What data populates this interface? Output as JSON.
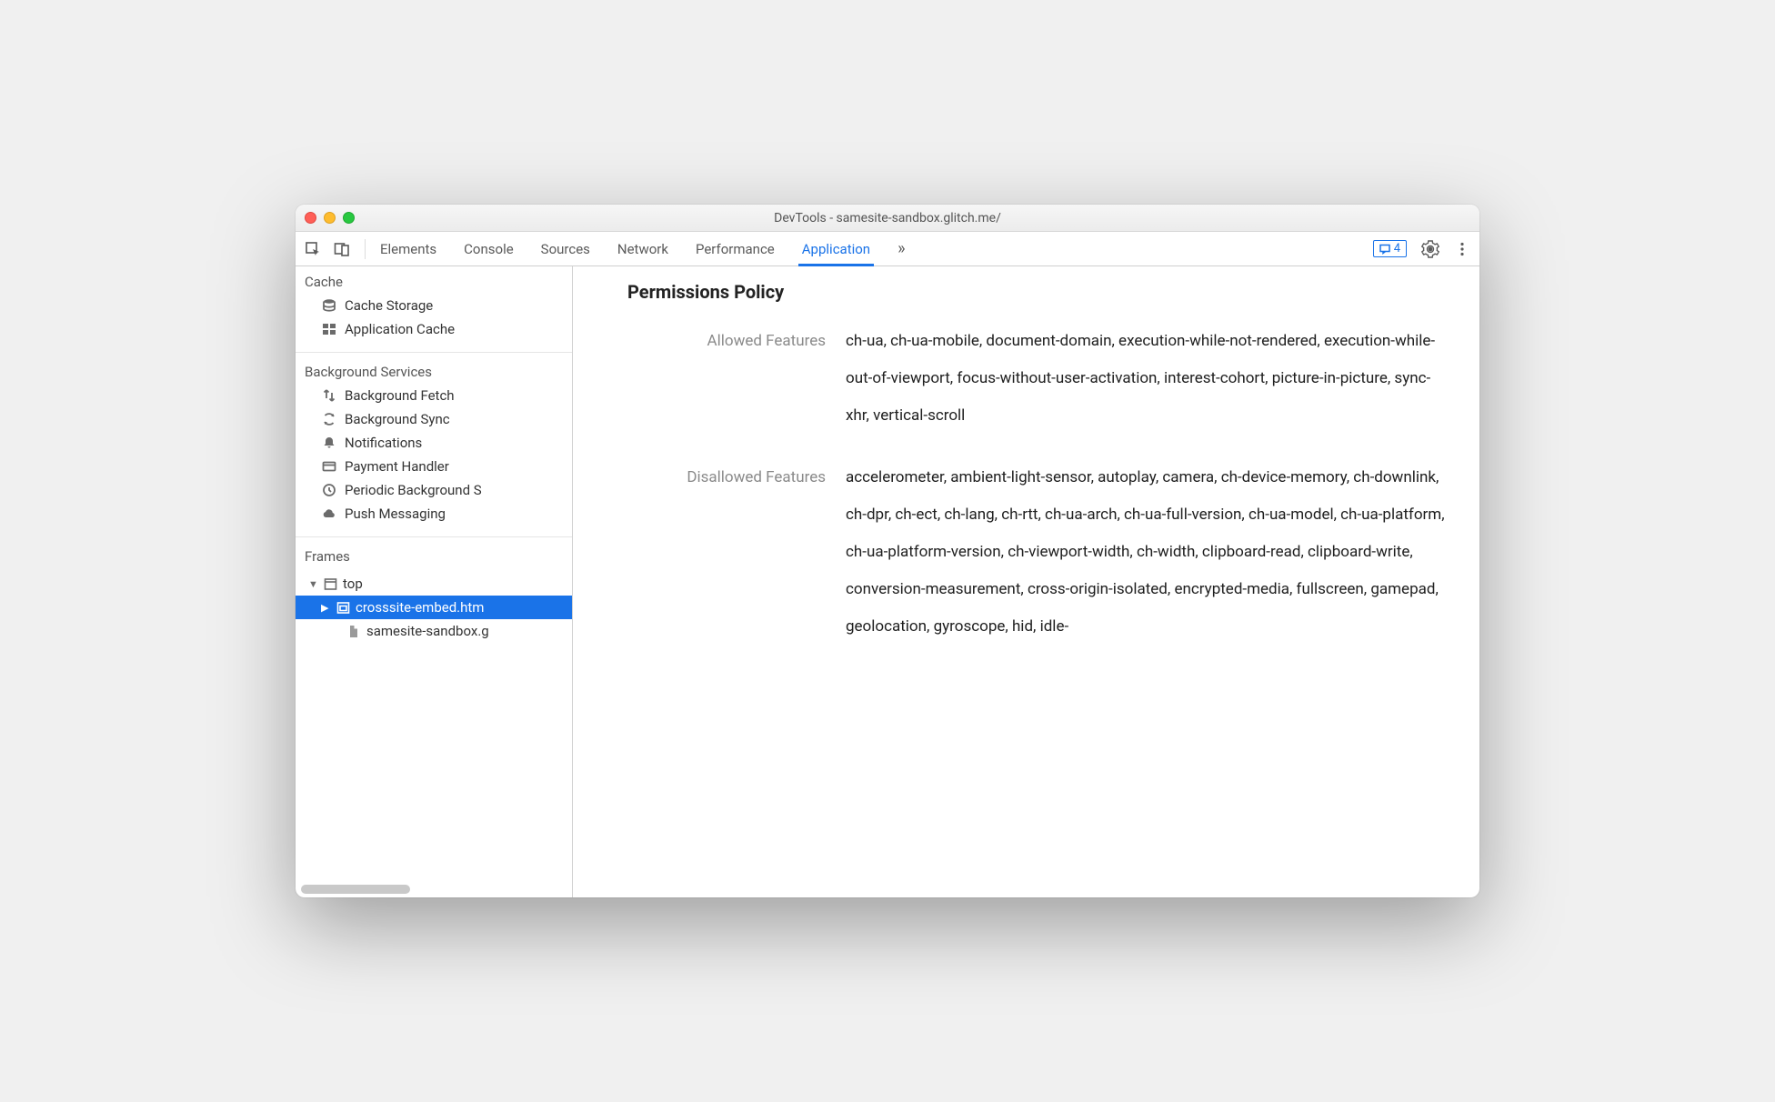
{
  "window": {
    "title": "DevTools - samesite-sandbox.glitch.me/"
  },
  "tabs": {
    "items": [
      "Elements",
      "Console",
      "Sources",
      "Network",
      "Performance",
      "Application"
    ],
    "active": "Application",
    "overflow_glyph": "»",
    "issues_count": "4"
  },
  "sidebar": {
    "cache": {
      "header": "Cache",
      "items": [
        {
          "label": "Cache Storage",
          "icon": "database-icon"
        },
        {
          "label": "Application Cache",
          "icon": "grid-icon"
        }
      ]
    },
    "background": {
      "header": "Background Services",
      "items": [
        {
          "label": "Background Fetch",
          "icon": "transfer-icon"
        },
        {
          "label": "Background Sync",
          "icon": "sync-icon"
        },
        {
          "label": "Notifications",
          "icon": "bell-icon"
        },
        {
          "label": "Payment Handler",
          "icon": "card-icon"
        },
        {
          "label": "Periodic Background S",
          "icon": "clock-icon"
        },
        {
          "label": "Push Messaging",
          "icon": "cloud-icon"
        }
      ]
    },
    "frames": {
      "header": "Frames",
      "tree": {
        "top": {
          "label": "top",
          "icon": "window-icon"
        },
        "child1": {
          "label": "crosssite-embed.htm",
          "icon": "iframe-icon",
          "selected": true
        },
        "child2": {
          "label": "samesite-sandbox.g",
          "icon": "file-icon"
        }
      }
    }
  },
  "panel": {
    "title": "Permissions Policy",
    "rows": [
      {
        "key": "Allowed Features",
        "value": "ch-ua, ch-ua-mobile, document-domain, execution-while-not-rendered, execution-while-out-of-viewport, focus-without-user-activation, interest-cohort, picture-in-picture, sync-xhr, vertical-scroll"
      },
      {
        "key": "Disallowed Features",
        "value": "accelerometer, ambient-light-sensor, autoplay, camera, ch-device-memory, ch-downlink, ch-dpr, ch-ect, ch-lang, ch-rtt, ch-ua-arch, ch-ua-full-version, ch-ua-model, ch-ua-platform, ch-ua-platform-version, ch-viewport-width, ch-width, clipboard-read, clipboard-write, conversion-measurement, cross-origin-isolated, encrypted-media, fullscreen, gamepad, geolocation, gyroscope, hid, idle-"
      }
    ]
  }
}
